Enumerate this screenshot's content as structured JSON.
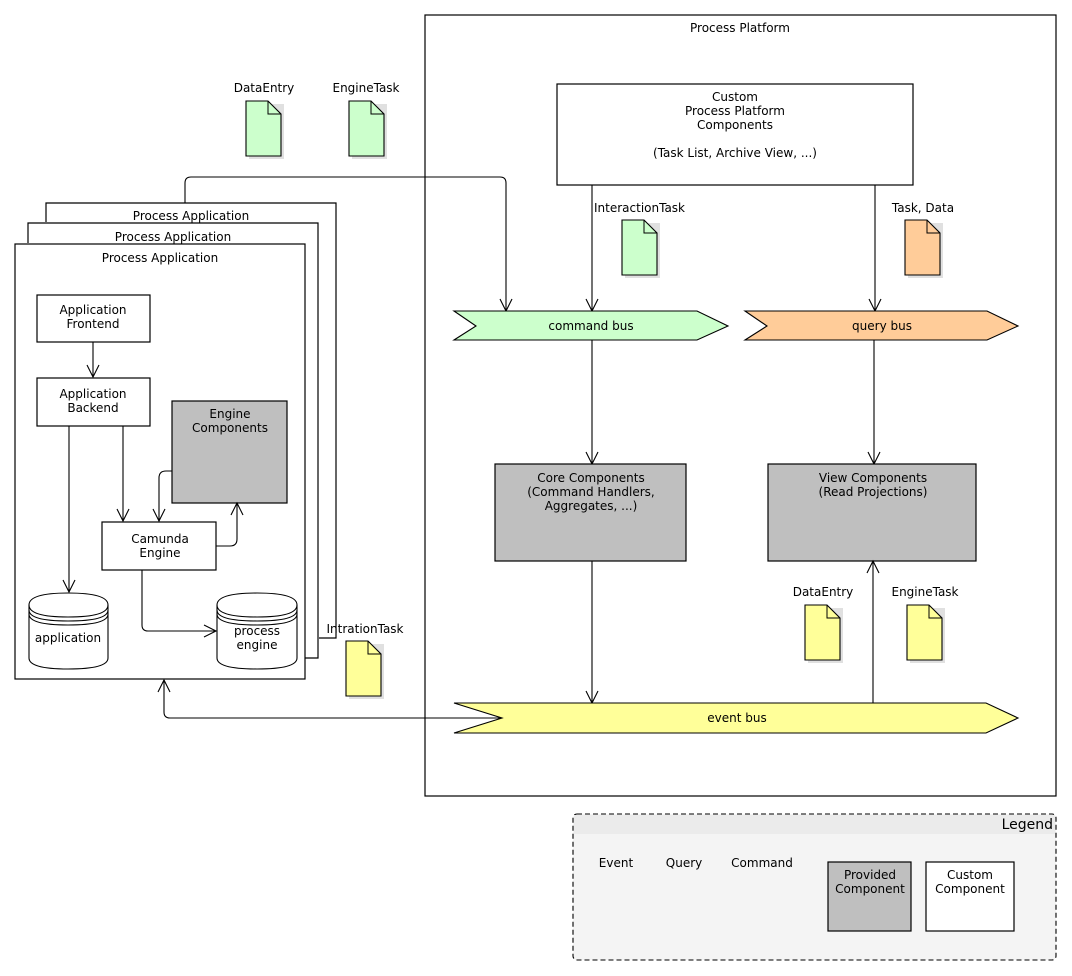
{
  "colors": {
    "event": "#ffff99",
    "query": "#ffcc99",
    "command": "#ccffcc",
    "provided": "#bfbfbf",
    "custom": "#ffffff",
    "legend_bg": "#f4f4f4"
  },
  "platform": {
    "title": "Process Platform",
    "custom_components": [
      "Custom",
      "Process Platform",
      "Components",
      "",
      "(Task List, Archive View, ...)"
    ],
    "core_components": [
      "Core Components",
      "(Command Handlers,",
      "Aggregates, ...)"
    ],
    "view_components": [
      "View Components",
      "(Read Projections)"
    ],
    "buses": {
      "command": "command bus",
      "query": "query bus",
      "event": "event bus"
    },
    "docs": {
      "interaction_task": "InteractionTask",
      "task_data": "Task, Data",
      "data_entry": "DataEntry",
      "engine_task": "EngineTask"
    }
  },
  "application": {
    "stack_titles": [
      "Process Application",
      "Process Application",
      "Process Application"
    ],
    "frontend": [
      "Application",
      "Frontend"
    ],
    "backend": [
      "Application",
      "Backend"
    ],
    "engine_components": [
      "Engine",
      "Components"
    ],
    "camunda_engine": [
      "Camunda",
      "Engine"
    ],
    "db_application": [
      "application"
    ],
    "db_process_engine": [
      "process",
      "engine"
    ]
  },
  "outside_docs": {
    "data_entry": "DataEntry",
    "engine_task": "EngineTask",
    "intration_task": "IntrationTask"
  },
  "legend": {
    "title": "Legend",
    "event": "Event",
    "query": "Query",
    "command": "Command",
    "provided": [
      "Provided",
      "Component"
    ],
    "custom": [
      "Custom",
      "Component"
    ]
  }
}
